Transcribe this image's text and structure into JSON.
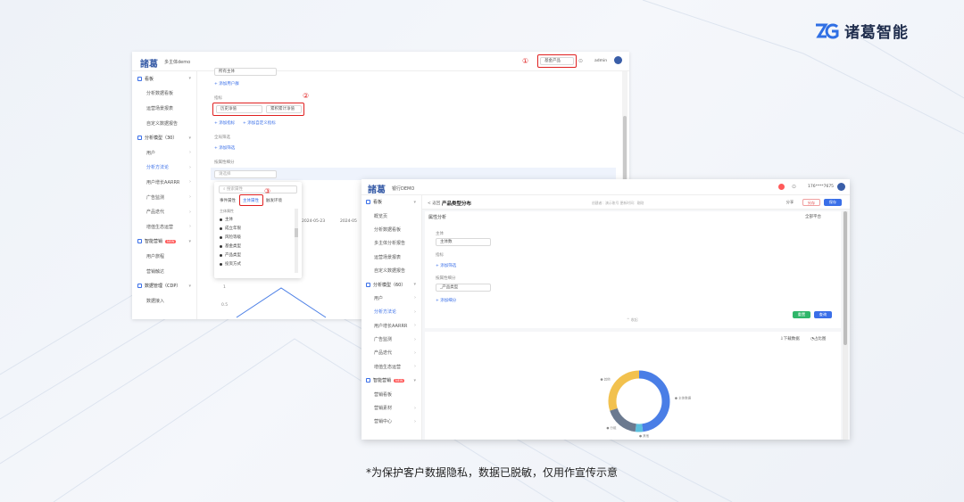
{
  "brand": {
    "name": "诸葛智能"
  },
  "caption": "*为保护客户数据隐私，数据已脱敏，仅用作宣传示意",
  "screen1": {
    "logo": "諸葛",
    "app_name": "多主体demo",
    "header": {
      "product_select": "基金产品",
      "user": "admin"
    },
    "nav": [
      {
        "label": "看板",
        "type": "group"
      },
      {
        "label": "分析数据看板"
      },
      {
        "label": "运营场景报表"
      },
      {
        "label": "自定义数据报告"
      },
      {
        "label": "分析模型（30）",
        "type": "group"
      },
      {
        "label": "用户"
      },
      {
        "label": "分析方法论",
        "active": true
      },
      {
        "label": "用户增长AARRR"
      },
      {
        "label": "广告监测"
      },
      {
        "label": "产品迭代"
      },
      {
        "label": "增值生态运营"
      },
      {
        "label": "智能营销",
        "type": "group",
        "badge": "NEW"
      },
      {
        "label": "用户旅程"
      },
      {
        "label": "营销触达"
      },
      {
        "label": "数据管理（CDP）",
        "type": "group"
      },
      {
        "label": "数据接入"
      }
    ],
    "form": {
      "subject_select": "所有主体",
      "add_user_group": "+ 添加用户群",
      "metric_label": "指标",
      "metric_select": "历史净值",
      "metric_agg": "累积累计净值",
      "add_metric": "+ 添加指标",
      "add_custom_metric": "+ 添加自定义指标",
      "global_filter_label": "全局筛选",
      "add_filter": "+ 添加筛选",
      "group_by_label": "按属性细分",
      "group_by_placeholder": "请选择"
    },
    "dropdown": {
      "search_placeholder": "搜索属性",
      "tabs": [
        "事件属性",
        "主体属性",
        "触发环境"
      ],
      "section": "主体属性",
      "items": [
        "主体",
        "成立年限",
        "风险等级",
        "基金类型",
        "产品类型",
        "投资方式"
      ]
    },
    "annotations": [
      "①",
      "②",
      "③"
    ],
    "dates": [
      "2024-05-23",
      "2024-05"
    ],
    "axis": [
      "1",
      "0.5"
    ]
  },
  "screen2": {
    "logo": "諸葛",
    "app_name": "银行DEMO",
    "user": "176****7675",
    "nav": [
      {
        "label": "看板",
        "type": "group"
      },
      {
        "label": "概览页"
      },
      {
        "label": "分析数据看板"
      },
      {
        "label": "多主体分析报告"
      },
      {
        "label": "运营场景报表"
      },
      {
        "label": "自定义数据报告"
      },
      {
        "label": "分析模型（60）",
        "type": "group"
      },
      {
        "label": "用户"
      },
      {
        "label": "分析方法论",
        "active": true
      },
      {
        "label": "用户增长AARRR"
      },
      {
        "label": "广告监测"
      },
      {
        "label": "产品迭代"
      },
      {
        "label": "增值生态运营"
      },
      {
        "label": "智能营销",
        "type": "group",
        "badge": "NEW"
      },
      {
        "label": "营销看板"
      },
      {
        "label": "营销素材"
      },
      {
        "label": "营销中心"
      }
    ],
    "header": {
      "back": "< 返回",
      "title": "产品类型分布",
      "meta": "创建者：演示账号    更新时间：刚刚",
      "btn_share": "分享",
      "btn_save_as": "另存",
      "btn_save": "保存"
    },
    "panel": {
      "tab": "属性分析",
      "platform": "全部平台",
      "subject_label": "主体",
      "subject_select": "主体数",
      "add_filter": "+ 添加筛选",
      "metric_label": "指标",
      "group_by_label": "按属性细分",
      "group_by_select": "_产品类型",
      "add_group": "+ 添加细分",
      "collapse": "^ 收起",
      "btn_reset": "重置",
      "btn_query": "查询"
    },
    "chart_toolbar": {
      "download": "下载数据",
      "chart_type": "占比图"
    },
    "chart_data": {
      "type": "pie",
      "title": "",
      "slices": [
        {
          "label": "主体数据",
          "value": 48,
          "color": "#4a7ee6"
        },
        {
          "label": "其他",
          "value": 4,
          "color": "#5bc0de"
        },
        {
          "label": "分组",
          "value": 18,
          "color": "#6b7a90"
        },
        {
          "label": "其他",
          "value": 30,
          "color": "#f2c14e"
        }
      ]
    }
  }
}
